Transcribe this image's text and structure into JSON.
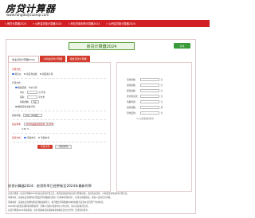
{
  "site": {
    "logo": "房贷计算器",
    "url": "www.fangdaijisuanqi.com"
  },
  "nav": [
    "房贷计算器2024",
    "公积金贷款计算器2024",
    "商业贷款利率计算器2024",
    "公积金贷款计算器2024"
  ],
  "header": {
    "title": "房贷计算器2024",
    "share_label": "分享"
  },
  "tabs": [
    "商业贷款计算器2024",
    "公积金贷款计算器",
    "组合贷款计算器"
  ],
  "form": {
    "calc_method_label": "计算方式：",
    "calc_methods": [
      "按房价",
      "按贷款总额",
      "按面积计算"
    ],
    "area_method_label": "计算方式：",
    "area_options": [
      "根据面积、单价计算",
      "根据贷款总额计算"
    ],
    "price_label": "单价：",
    "price_unit": "元/平米",
    "area_label": "面积：",
    "area_unit": "平方米",
    "ratio_label": "按揭成数：",
    "ratio_value": "7成",
    "term_label": "按揭年数：",
    "term_value": "20年（240期）",
    "rate_label": "商业利率：",
    "rate_value": "2024年最新基准利率（4.90%）",
    "rate_pct": "4.90",
    "rate_pct_unit": "%",
    "repay_label": "还款方式：",
    "repay_options": [
      "等额本息",
      "等额本金"
    ],
    "calc_button": "开始计算",
    "reset_button": "重新填写"
  },
  "results": {
    "rows": [
      {
        "label": "房款总额：",
        "unit": "元"
      },
      {
        "label": "贷款总额：",
        "unit": "元"
      },
      {
        "label": "还款总额：",
        "unit": "元"
      },
      {
        "label": "支付利息款：",
        "unit": "元"
      },
      {
        "label": "首期付款：",
        "unit": "元"
      },
      {
        "label": "贷款月数：",
        "unit": "月"
      },
      {
        "label": "月均还款：",
        "unit": "元"
      }
    ],
    "note": "*以上结果仅供参考"
  },
  "article": {
    "title": "房贷计算器2024：房贷利率已经更新至2024年最新利率",
    "lines": [
      "房贷计算器 - 房贷计算器2024是专业贷款计算工具，我们提供最新的房贷计算器功能，支持商业贷款、公积金贷款等多种计算方式。",
      "等额本息：是指在还款期内每月偿还同等数额的贷款（包括本金和利息），每月还款额固定，借款人还款压力均衡。",
      "等额本金：是指在还款期内把贷款数总额等分，每月偿还同等数额的本金和剩余贷款在该月所产生的利息。",
      "2024年公积金贷款利率调整说明：具体以当地公积金中心公布为准，请以实际情况为准。",
      "房贷计算器2024年最新版，支持等额本息和等额本金两种还款方式计算，结果仅供参考。"
    ]
  }
}
